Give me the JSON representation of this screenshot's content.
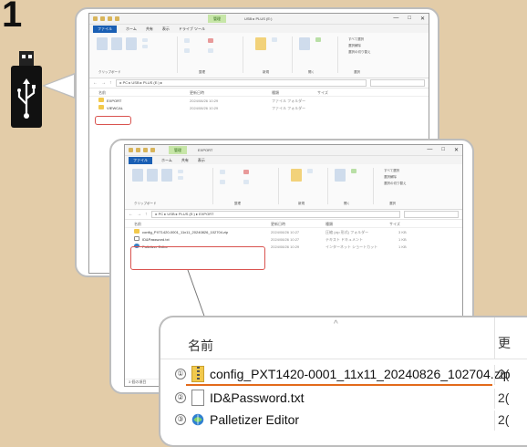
{
  "step_number": "1",
  "window1": {
    "tab_manage": "管理",
    "title": "USB ▸ PLUS (E:)",
    "tabs": [
      "ファイル",
      "ホーム",
      "共有",
      "表示",
      "ドライブ ツール"
    ],
    "address": "▸ PC ▸ USB ▸ PLUS (E:) ▸",
    "columns": [
      "名前",
      "更新日時",
      "種類",
      "サイズ"
    ],
    "rows": [
      {
        "name": "EXPORT",
        "date": "2024/08/26 10:29",
        "type": "ファイル フォルダー"
      },
      {
        "name": "VIEWCAL",
        "date": "2024/08/26 10:29",
        "type": "ファイル フォルダー"
      }
    ],
    "group_labels": [
      "クリップボード",
      "整理",
      "新規",
      "開く",
      "選択"
    ],
    "select_items": [
      "すべて選択",
      "選択解除",
      "選択の切り替え"
    ]
  },
  "window2": {
    "tab_manage": "管理",
    "title": "EXPORT",
    "tabs": [
      "ファイル",
      "ホーム",
      "共有",
      "表示"
    ],
    "address": "▸ PC ▸ USB ▸ PLUS (E:) ▸ EXPORT",
    "columns": [
      "名前",
      "更新日時",
      "種類",
      "サイズ"
    ],
    "rows": [
      {
        "name": "config_PXT1420-0001_11x11_20240826_102704.zip",
        "date": "2024/08/26 10:27",
        "type": "圧縮 (zip 形式) フォルダー",
        "size": "3 KB"
      },
      {
        "name": "ID&Password.txt",
        "date": "2024/08/26 10:27",
        "type": "テキスト ドキュメント",
        "size": "1 KB"
      },
      {
        "name": "Palletizer Editor",
        "date": "2024/08/26 10:29",
        "type": "インターネット ショートカット",
        "size": "1 KB"
      }
    ],
    "group_labels": [
      "クリップボード",
      "整理",
      "新規",
      "開く",
      "選択"
    ],
    "select_items": [
      "すべて選択",
      "選択解除",
      "選択の切り替え"
    ],
    "status": "3 個の項目"
  },
  "zoom": {
    "column_label": "名前",
    "next_column_label": "更",
    "rows": [
      {
        "num": "①",
        "name": "config_PXT1420-0001_11x11_20240826_102704.zip",
        "date": "2("
      },
      {
        "num": "②",
        "name": "ID&Password.txt",
        "date": "2("
      },
      {
        "num": "③",
        "name": "Palletizer Editor",
        "date": "2("
      }
    ]
  },
  "colors": {
    "background": "#e3cca8",
    "highlight": "#d9534f",
    "underline": "#e36a1b",
    "file_tab": "#1a5fb4"
  }
}
